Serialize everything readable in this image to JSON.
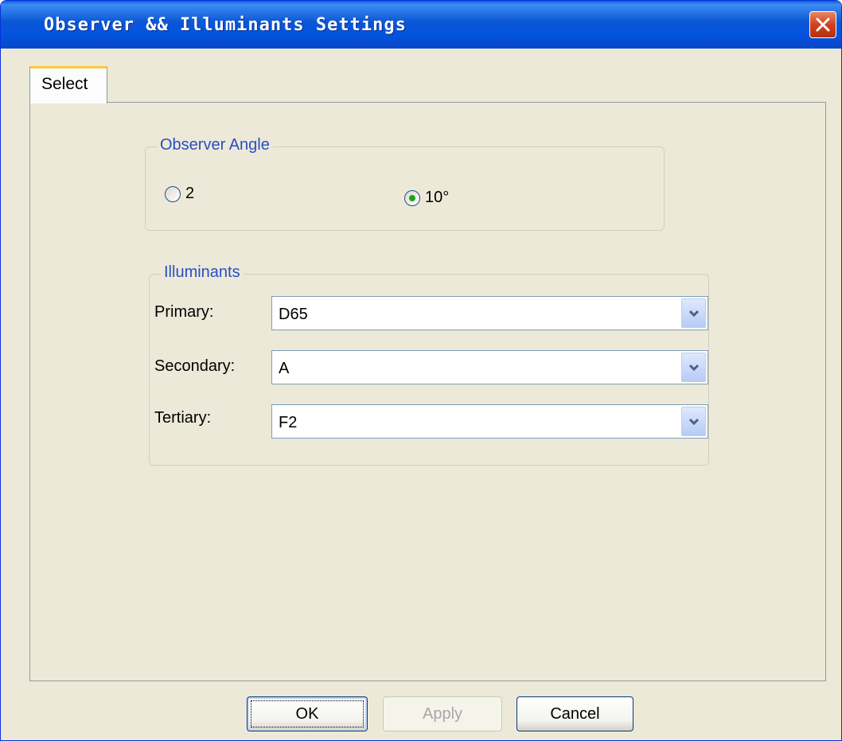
{
  "window": {
    "title": "Observer && Illuminants Settings",
    "close_icon": "close-icon"
  },
  "tabs": [
    {
      "label": "Select",
      "selected": true
    }
  ],
  "observer_angle": {
    "title": "Observer Angle",
    "options": [
      {
        "label": "2",
        "checked": false
      },
      {
        "label": "10°",
        "checked": true
      }
    ]
  },
  "illuminants": {
    "title": "Illuminants",
    "primary": {
      "label": "Primary:",
      "value": "D65"
    },
    "secondary": {
      "label": "Secondary:",
      "value": "A"
    },
    "tertiary": {
      "label": "Tertiary:",
      "value": "F2"
    }
  },
  "buttons": {
    "ok": "OK",
    "apply": "Apply",
    "cancel": "Cancel"
  },
  "colors": {
    "titlebar": "#0a56d6",
    "window_bg": "#ece9d8",
    "group_title": "#2a4ec4",
    "close_button": "#d2421c"
  }
}
